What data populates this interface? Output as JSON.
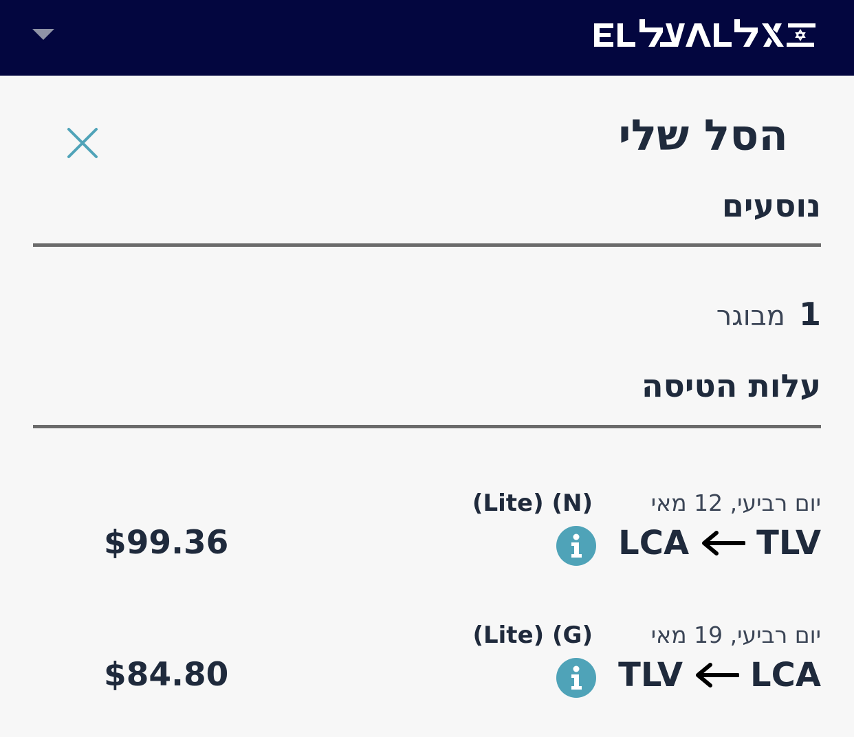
{
  "header": {
    "logo_text": "ELAL אל על",
    "colors": {
      "background": "#03063f",
      "caret": "#8f93a6"
    }
  },
  "cart": {
    "title": "הסל שלי"
  },
  "passengers": {
    "heading": "נוסעים",
    "count": "1",
    "type": "מבוגר"
  },
  "flight_cost": {
    "heading": "עלות הטיסה",
    "flights": [
      {
        "date": "יום רביעי, 12 מאי",
        "fare": "(Lite) (N)",
        "origin": "TLV",
        "destination": "LCA",
        "price": "$99.36"
      },
      {
        "date": "יום רביעי, 19 מאי",
        "fare": "(Lite) (G)",
        "origin": "LCA",
        "destination": "TLV",
        "price": "$84.80"
      }
    ]
  },
  "icons": {
    "close": "close-icon",
    "dropdown": "chevron-down-icon",
    "info": "info-icon",
    "arrow": "arrow-left-icon"
  },
  "colors": {
    "accent": "#4fa3b8",
    "text": "#1f2a3c",
    "divider": "#6b6b6b"
  }
}
